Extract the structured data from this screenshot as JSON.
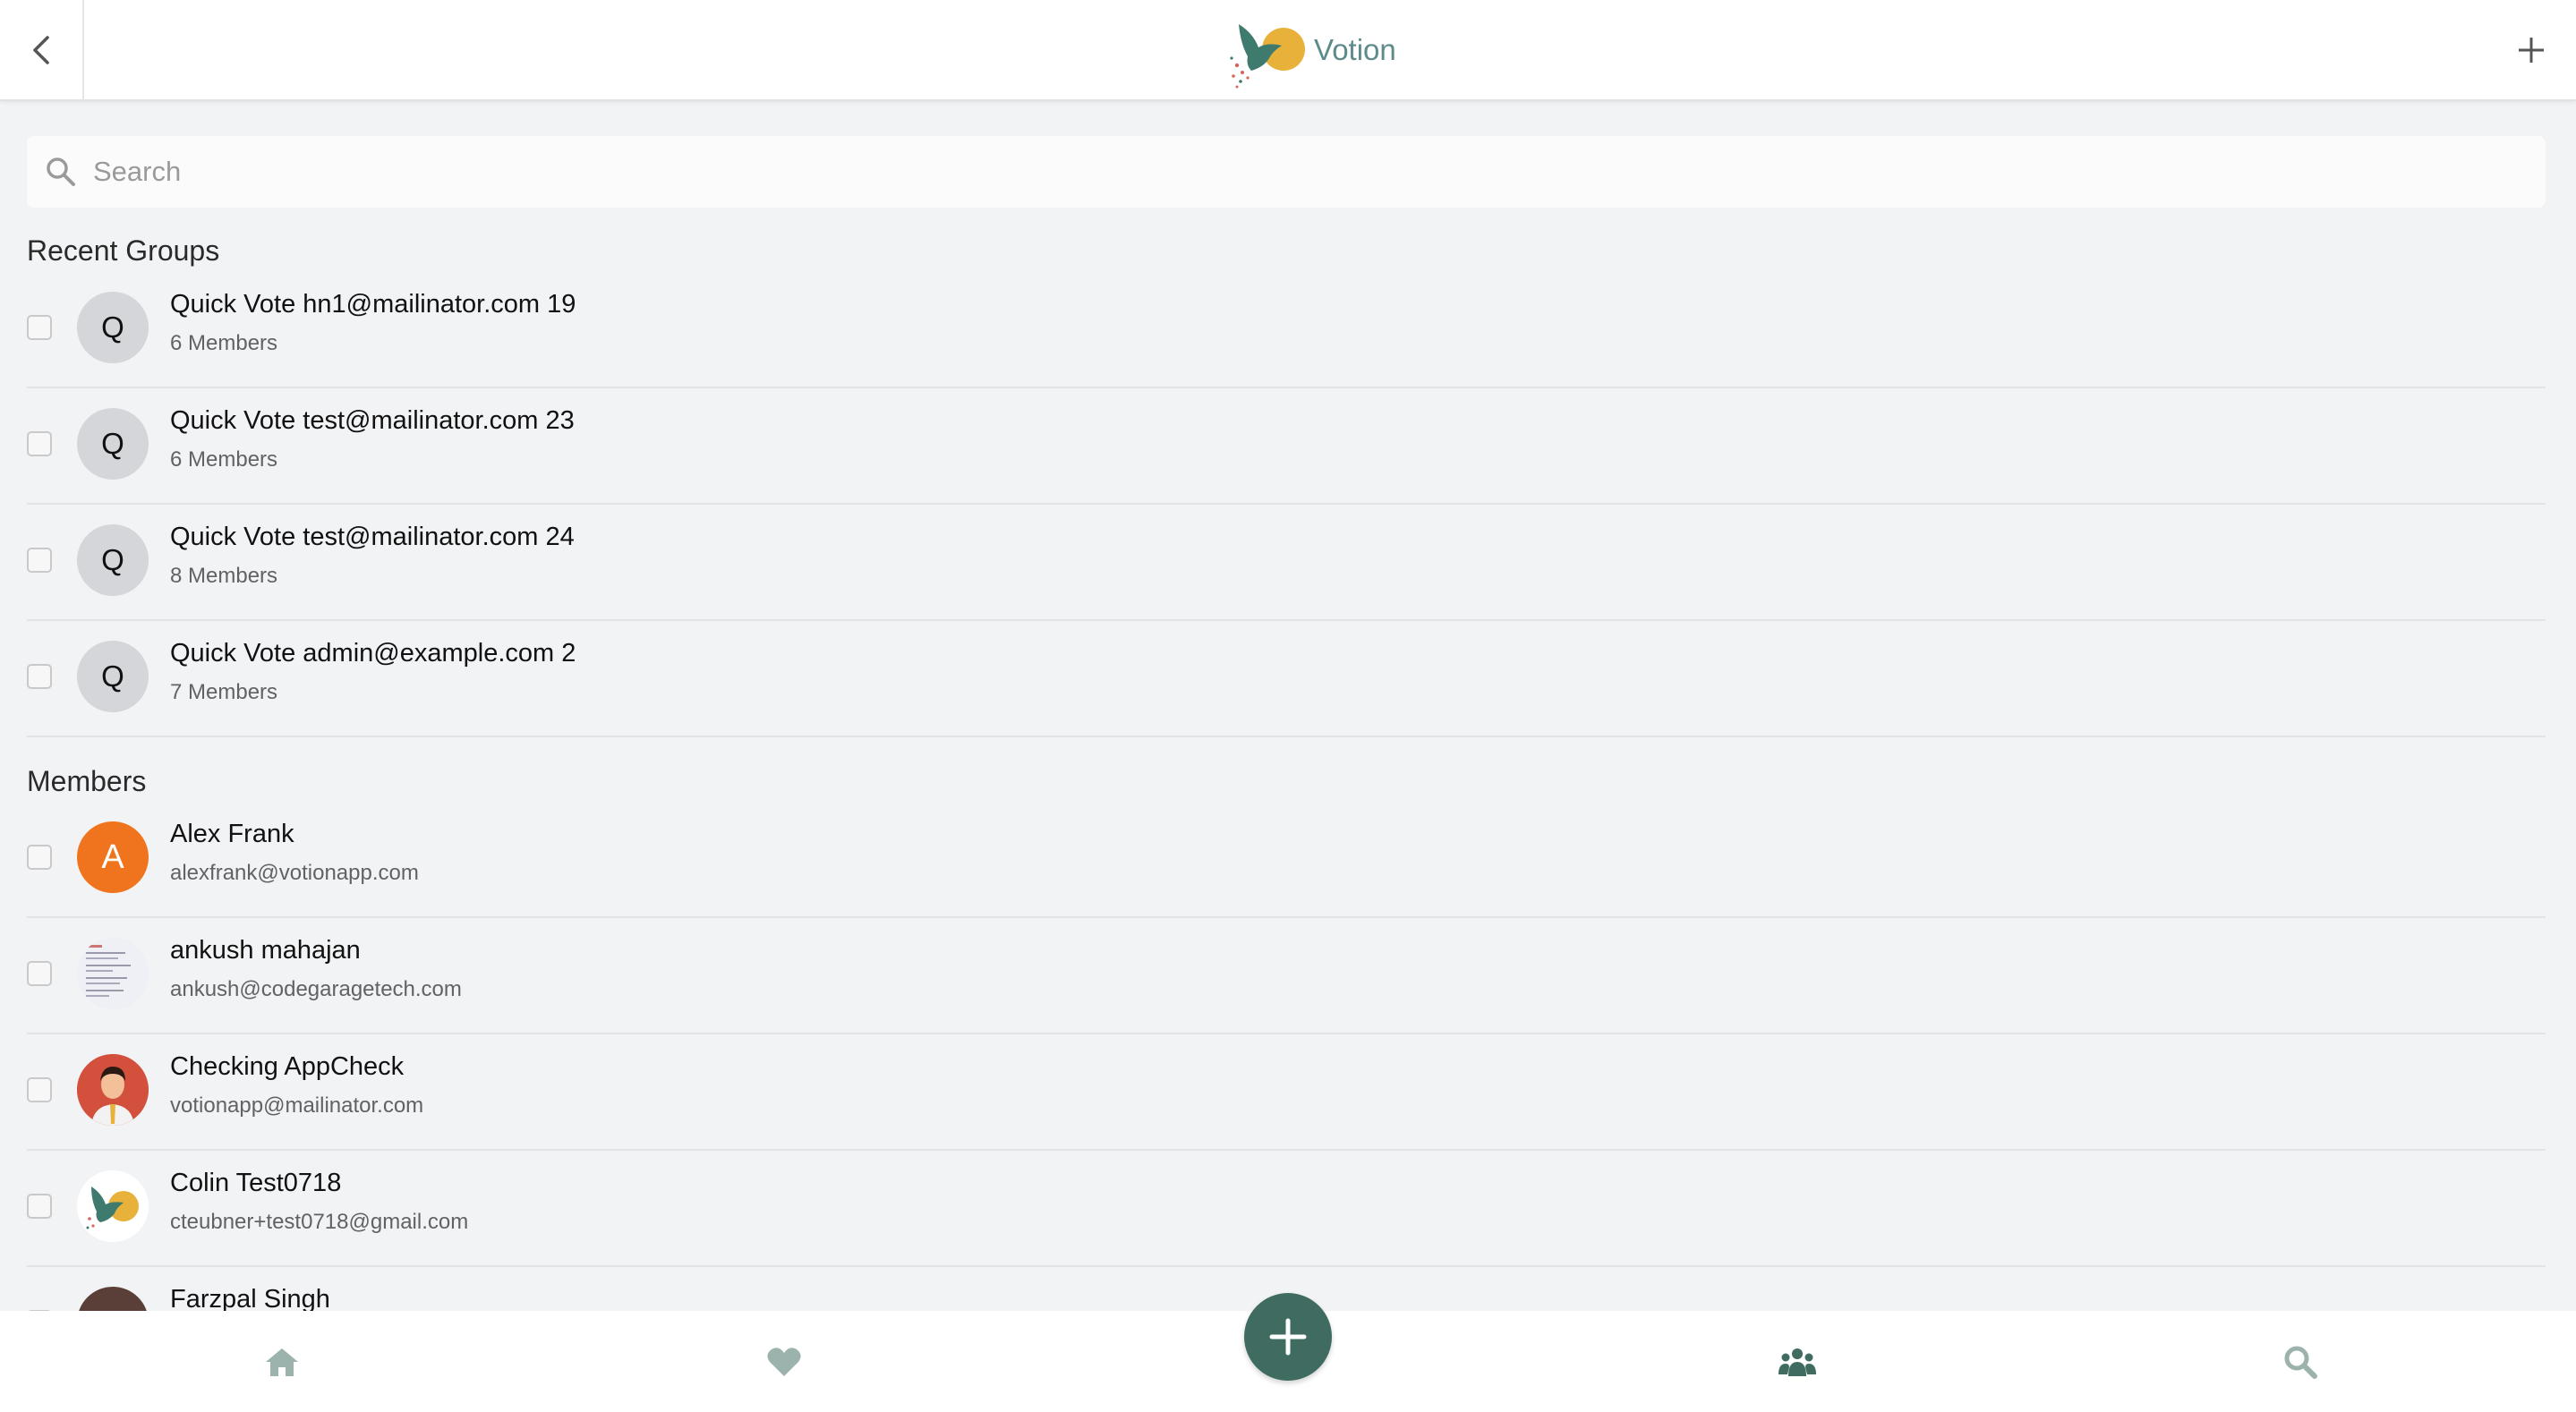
{
  "app": {
    "brand": "Votion",
    "accent_color": "#3f6b61",
    "logo_color": "#5d8a8a"
  },
  "header": {
    "back_icon": "chevron-left-icon",
    "add_icon": "plus-icon"
  },
  "search": {
    "placeholder": "Search",
    "value": ""
  },
  "recent_groups": {
    "title": "Recent Groups",
    "items": [
      {
        "initial": "Q",
        "name": "Quick Vote hn1@mailinator.com 19",
        "members": "6 Members"
      },
      {
        "initial": "Q",
        "name": "Quick Vote test@mailinator.com 23",
        "members": "6 Members"
      },
      {
        "initial": "Q",
        "name": "Quick Vote test@mailinator.com 24",
        "members": "8 Members"
      },
      {
        "initial": "Q",
        "name": "Quick Vote admin@example.com 2",
        "members": "7 Members"
      }
    ]
  },
  "members": {
    "title": "Members",
    "items": [
      {
        "initial": "A",
        "name": "Alex Frank",
        "email": "alexfrank@votionapp.com",
        "avatar": "letter"
      },
      {
        "name": "ankush mahajan",
        "email": "ankush@codegaragetech.com",
        "avatar": "screenshot-thumbnail"
      },
      {
        "name": "Checking AppCheck",
        "email": "votionapp@mailinator.com",
        "avatar": "person-illustration"
      },
      {
        "name": "Colin Test0718",
        "email": "cteubner+test0718@gmail.com",
        "avatar": "votion-logo"
      },
      {
        "name": "Farzpal Singh",
        "email": "",
        "avatar": "dark-photo"
      }
    ]
  },
  "tabbar": {
    "tabs": [
      {
        "icon": "home-icon",
        "active": false
      },
      {
        "icon": "heart-icon",
        "active": false
      },
      {
        "icon": "people-icon",
        "active": true
      },
      {
        "icon": "search-icon",
        "active": false
      }
    ],
    "fab_icon": "plus-icon"
  }
}
